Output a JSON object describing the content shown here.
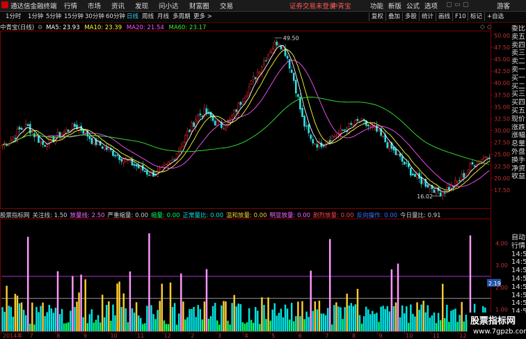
{
  "menubar": {
    "app_title": "通达信金融终端",
    "items": [
      "行情",
      "市场",
      "资讯",
      "发现",
      "问小达",
      "财富圈",
      "交易"
    ],
    "notice": "证券交易未登录",
    "stock": "中青宝",
    "right_items": [
      "功能",
      "新版",
      "公式",
      "选项"
    ],
    "guest": "游客"
  },
  "toolbar": {
    "periods": [
      "1分时",
      "1分钟",
      "5分钟",
      "15分钟",
      "30分钟",
      "60分钟",
      "日线",
      "周线",
      "月线",
      "多周期",
      "更多 >"
    ],
    "active_period": "日线",
    "right_buttons": [
      "复权",
      "叠加",
      "多股",
      "统计",
      "画线",
      "F10",
      "标记",
      "+自选"
    ]
  },
  "ma_legend": {
    "title": "中青宝(日线)",
    "ma5": "MA5: 23.93",
    "ma10": "MA10: 23.39",
    "ma20": "MA20: 21.54",
    "ma60": "MA60: 23.17"
  },
  "indicator_legend": [
    {
      "text": "股票指标网",
      "color": "#d0d0d0"
    },
    {
      "text": "关注线: 1.50",
      "color": "#d0d0d0"
    },
    {
      "text": "放量线: 2.50",
      "color": "#ff66ff"
    },
    {
      "text": "严重缩量: 0.00",
      "color": "#d0d0d0"
    },
    {
      "text": "缩量: 0.00",
      "color": "#00ff66"
    },
    {
      "text": "正常量比: 0.00",
      "color": "#00e5e5"
    },
    {
      "text": "温和放量: 0.00",
      "color": "#ffcc33"
    },
    {
      "text": "明显放量: 0.00",
      "color": "#ff66ff"
    },
    {
      "text": "剧烈放量: 0.00",
      "color": "#ff4444"
    },
    {
      "text": "反向操作: 0.00",
      "color": "#3377ff"
    },
    {
      "text": "今日量比: 0.91",
      "color": "#d0d0d0"
    }
  ],
  "price_axis": [
    "50.00",
    "47.50",
    "45.00",
    "42.50",
    "40.00",
    "37.50",
    "35.00",
    "32.50",
    "30.00",
    "27.50",
    "25.00",
    "22.50",
    "20.00",
    "17.50"
  ],
  "ind_axis": [
    "4.00",
    "3.00",
    "2.19",
    "2.00",
    "1.00"
  ],
  "annotations": {
    "high": "49.50",
    "low": "16.02"
  },
  "month_axis": [
    "2014年",
    "7",
    "8",
    "9",
    "10",
    "11",
    "12",
    "2",
    "3",
    "4",
    "5",
    "6",
    "7",
    "8",
    "9",
    "10",
    "11",
    "12"
  ],
  "right_panel_top": [
    "委比",
    "卖五",
    "卖四",
    "卖三",
    "卖二",
    "卖一",
    "买一",
    "买二",
    "买三",
    "买四",
    "买五",
    "现价",
    "涨跌",
    "涨幅",
    "总量",
    "外盘",
    "换手",
    "净资",
    "收益"
  ],
  "right_panel_bottom": [
    "自动",
    "行情",
    "14:5",
    "14:5",
    "14:5",
    "14:5",
    "14:5",
    "14:5",
    "14:5",
    "14:5"
  ],
  "watermark": {
    "title": "股票指标网",
    "url": "www.7gpzb.com"
  },
  "colors": {
    "up": "#ff3030",
    "down": "#30e0e0",
    "ma5": "#ffffff",
    "ma10": "#ffff33",
    "ma20": "#ff55ff",
    "ma60": "#33ee33"
  },
  "chart_data": {
    "type": "line",
    "price_ylim": [
      15,
      51
    ],
    "price_path": [
      27,
      28,
      30,
      31,
      29,
      27,
      28,
      29,
      30,
      31,
      30,
      28,
      27,
      26,
      25,
      24,
      23,
      22,
      21,
      21,
      22,
      24,
      27,
      30,
      33,
      34,
      32,
      31,
      32,
      35,
      38,
      41,
      44,
      47,
      49,
      46,
      40,
      32,
      28,
      27,
      28,
      29,
      30,
      31,
      32,
      31,
      30,
      28,
      26,
      24,
      22,
      20,
      19,
      18,
      17,
      18,
      19,
      21,
      23,
      24,
      25
    ],
    "volume_ratio_lines": {
      "watch": 1.5,
      "surge": 2.5,
      "today": 2.19
    },
    "vol_ylim": [
      0,
      5
    ]
  }
}
